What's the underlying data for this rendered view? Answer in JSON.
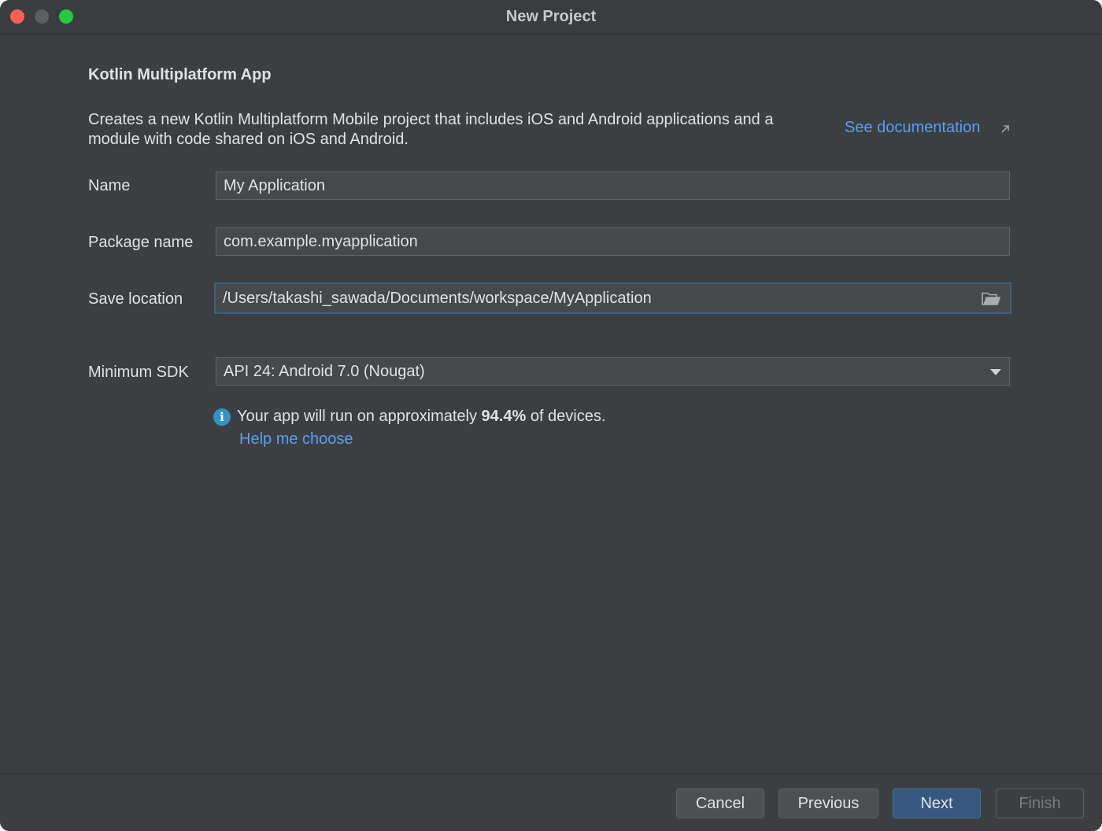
{
  "window": {
    "title": "New Project"
  },
  "header": {
    "heading": "Kotlin Multiplatform App",
    "description": "Creates a new Kotlin Multiplatform Mobile project that includes iOS and Android applications and a module with code shared on iOS and Android.",
    "doc_link": "See documentation"
  },
  "form": {
    "name_label": "Name",
    "name_value": "My Application",
    "package_label": "Package name",
    "package_value": "com.example.myapplication",
    "location_label": "Save location",
    "location_value": "/Users/takashi_sawada/Documents/workspace/MyApplication",
    "sdk_label": "Minimum SDK",
    "sdk_value": "API 24: Android 7.0 (Nougat)"
  },
  "info": {
    "icon": "info-icon",
    "prefix": "Your app will run on approximately ",
    "percent": "94.4%",
    "suffix": " of devices.",
    "help_link": "Help me choose"
  },
  "buttons": {
    "cancel": "Cancel",
    "previous": "Previous",
    "next": "Next",
    "finish": "Finish"
  },
  "colors": {
    "background": "#3c3f41",
    "link": "#589df6",
    "primary_button": "#365880",
    "focus_border": "#3d6185"
  }
}
